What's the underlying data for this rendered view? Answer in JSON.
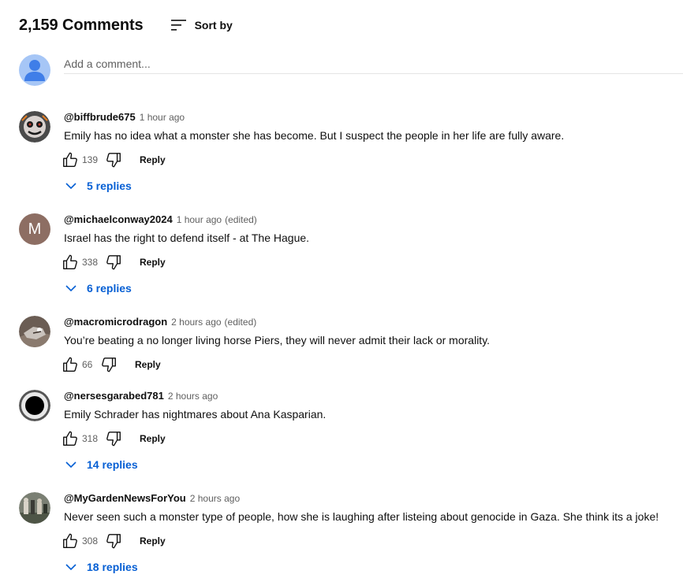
{
  "header": {
    "comment_count": "2,159 Comments",
    "sort_label": "Sort by"
  },
  "add_comment": {
    "placeholder": "Add a comment..."
  },
  "comments": [
    {
      "handle": "@biffbrude675",
      "time": "1 hour ago",
      "edited": "",
      "text": "Emily has no idea what a monster she has become. But I suspect the people in her life are fully aware.",
      "likes": "139",
      "reply_label": "Reply",
      "replies_label": "5 replies"
    },
    {
      "handle": "@michaelconway2024",
      "time": "1 hour ago",
      "edited": "(edited)",
      "avatar_letter": "M",
      "text": "Israel has the right to defend itself - at The Hague.",
      "likes": "338",
      "reply_label": "Reply",
      "replies_label": "6 replies"
    },
    {
      "handle": "@macromicrodragon",
      "time": "2 hours ago",
      "edited": "(edited)",
      "text": "You’re beating a no longer living horse Piers, they will never admit their lack or morality.",
      "likes": "66",
      "reply_label": "Reply",
      "replies_label": ""
    },
    {
      "handle": "@nersesgarabed781",
      "time": "2 hours ago",
      "edited": "",
      "text": "Emily Schrader has nightmares about Ana Kasparian.",
      "likes": "318",
      "reply_label": "Reply",
      "replies_label": "14 replies"
    },
    {
      "handle": "@MyGardenNewsForYou",
      "time": "2 hours ago",
      "edited": "",
      "text": "Never seen such a monster type of people, how she is laughing after listeing about genocide in Gaza. She think its a joke!",
      "likes": "308",
      "reply_label": "Reply",
      "replies_label": "18 replies"
    }
  ],
  "icons": {
    "sort": "sort-icon",
    "like": "thumbs-up-icon",
    "dislike": "thumbs-down-icon",
    "expand": "chevron-down-icon"
  },
  "colors": {
    "link_blue": "#065fd4",
    "secondary_text": "#606060",
    "avatar_m": "#8d6e63",
    "self_avatar_bg": "#a6c6f6",
    "self_avatar_fg": "#3f7ee8"
  }
}
